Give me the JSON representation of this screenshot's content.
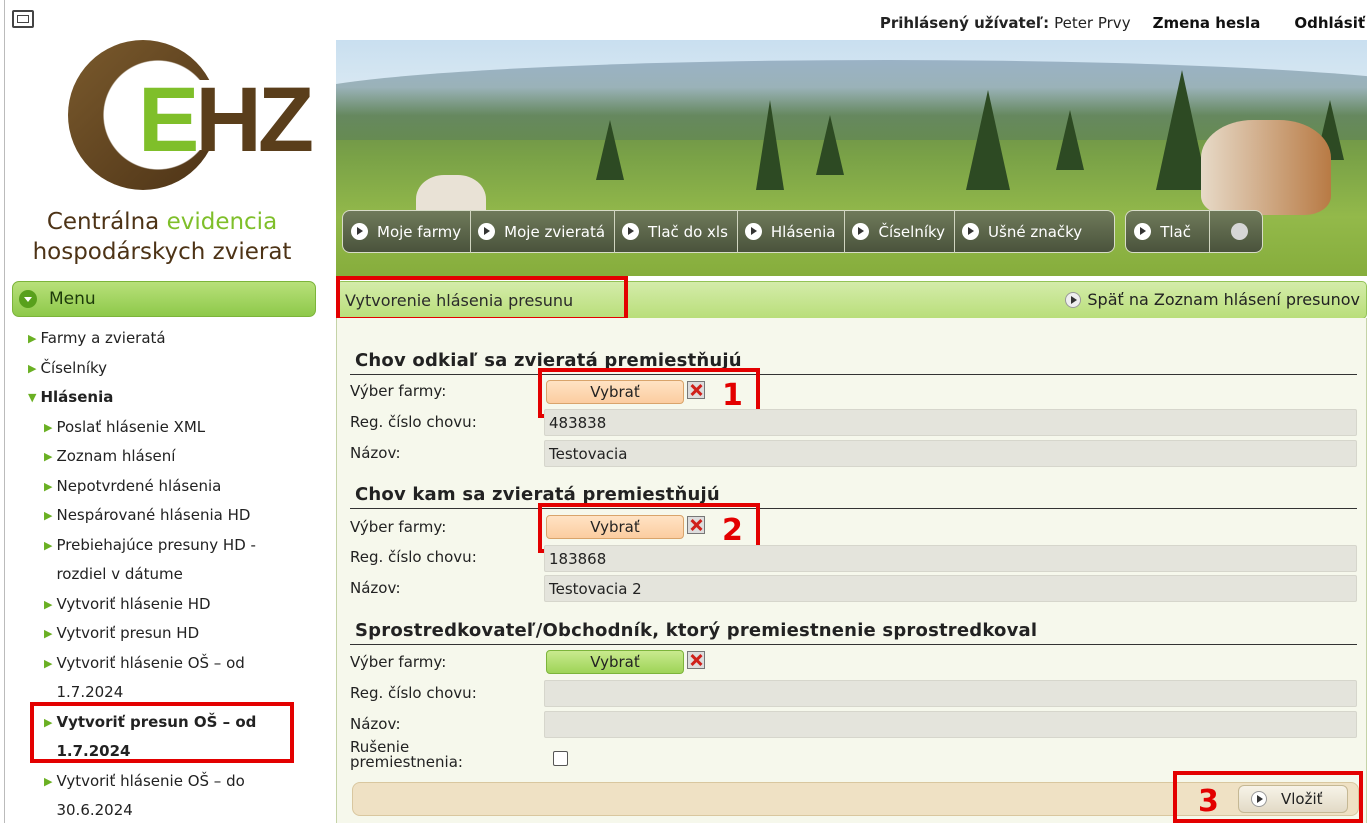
{
  "header": {
    "user_label": "Prihlásený užívateľ:",
    "user_name": "Peter Prvy",
    "change_password": "Zmena hesla",
    "logout": "Odhlásiť"
  },
  "logo": {
    "e": "E",
    "hz": "HZ",
    "subtitle_1a": "Centrálna ",
    "subtitle_1b": "evidencia",
    "subtitle_2": "hospodárskych zvierat"
  },
  "main_nav": {
    "items": [
      "Moje farmy",
      "Moje zvieratá",
      "Tlač do xls",
      "Hlásenia",
      "Číselníky",
      "Ušné značky",
      "Tlač"
    ]
  },
  "sidebar": {
    "menu_title": "Menu",
    "items": [
      {
        "label": "Farmy a zvieratá"
      },
      {
        "label": "Číselníky"
      },
      {
        "label": "Hlásenia"
      }
    ],
    "sub_items": [
      {
        "label": "Poslať hlásenie XML"
      },
      {
        "label": "Zoznam hlásení"
      },
      {
        "label": "Nepotvrdené hlásenia"
      },
      {
        "label": "Nespárované hlásenia HD"
      },
      {
        "label": "Prebiehajúce presuny HD -",
        "label2": "rozdiel v dátume"
      },
      {
        "label": "Vytvoriť hlásenie HD"
      },
      {
        "label": "Vytvoriť presun HD"
      },
      {
        "label": "Vytvoriť hlásenie OŠ – od",
        "label2": "1.7.2024"
      },
      {
        "label": "Vytvoriť presun OŠ – od",
        "label2": "1.7.2024"
      },
      {
        "label": "Vytvoriť hlásenie OŠ – do",
        "label2": "30.6.2024"
      }
    ]
  },
  "page": {
    "title": "Vytvorenie hlásenia presunu",
    "back_link": "Späť na Zoznam hlásení presunov"
  },
  "sections": [
    {
      "title": "Chov odkiaľ sa zvieratá premiestňujú",
      "select_label": "Výber farmy:",
      "select_button": "Vybrať",
      "reg_label": "Reg. číslo chovu:",
      "reg_value": "483838",
      "name_label": "Názov:",
      "name_value": "Testovacia",
      "marker": "1"
    },
    {
      "title": "Chov kam sa zvieratá premiestňujú",
      "select_label": "Výber farmy:",
      "select_button": "Vybrať",
      "reg_label": "Reg. číslo chovu:",
      "reg_value": "183868",
      "name_label": "Názov:",
      "name_value": "Testovacia 2",
      "marker": "2"
    },
    {
      "title": "Sprostredkovateľ/Obchodník, ktorý premiestnenie sprostredkoval",
      "select_label": "Výber farmy:",
      "select_button": "Vybrať",
      "reg_label": "Reg. číslo chovu:",
      "reg_value": "",
      "name_label": "Názov:",
      "name_value": ""
    }
  ],
  "cancel": {
    "label_1": "Rušenie",
    "label_2": "premiestnenia:"
  },
  "submit": {
    "label": "Vložiť",
    "marker": "3"
  },
  "colors": {
    "highlight_red": "#e30000",
    "menu_green": "#8ec94a",
    "select_orange": "#fbcda0"
  }
}
